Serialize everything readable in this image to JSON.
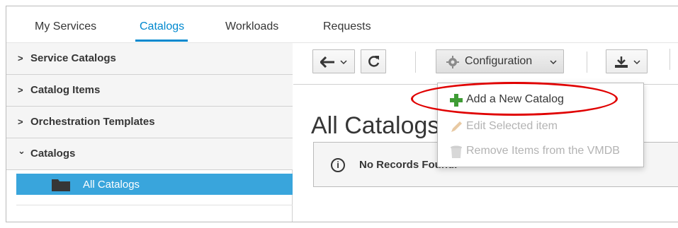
{
  "nav": {
    "tabs": [
      {
        "label": "My Services"
      },
      {
        "label": "Catalogs"
      },
      {
        "label": "Workloads"
      },
      {
        "label": "Requests"
      }
    ],
    "active_tab": "Catalogs"
  },
  "sidebar": {
    "accordions": [
      {
        "label": "Service Catalogs",
        "chevron": ">"
      },
      {
        "label": "Catalog Items",
        "chevron": ">"
      },
      {
        "label": "Orchestration Templates",
        "chevron": ">"
      },
      {
        "label": "Catalogs",
        "chevron": "⌄"
      }
    ],
    "tree_selected": {
      "label": "All Catalogs",
      "icon": "folder-icon"
    }
  },
  "toolbar": {
    "back_icon": "arrow-left-icon",
    "refresh_icon": "refresh-icon",
    "configuration_label": "Configuration",
    "configuration_icon": "gear-icon",
    "download_icon": "download-icon"
  },
  "main": {
    "title": "All Catalogs",
    "alert_message": "No Records Found.",
    "alert_icon": "info-icon"
  },
  "dropdown": {
    "items": [
      {
        "label": "Add a New Catalog",
        "icon": "plus-icon",
        "enabled": true
      },
      {
        "label": "Edit Selected item",
        "icon": "pencil-icon",
        "enabled": false
      },
      {
        "label": "Remove Items from the VMDB",
        "icon": "trash-icon",
        "enabled": false
      }
    ]
  },
  "colors": {
    "accent": "#0088ce",
    "selected_tree": "#39a5dc",
    "highlight_ring": "#e00000",
    "plus_green": "#3f9c35"
  }
}
